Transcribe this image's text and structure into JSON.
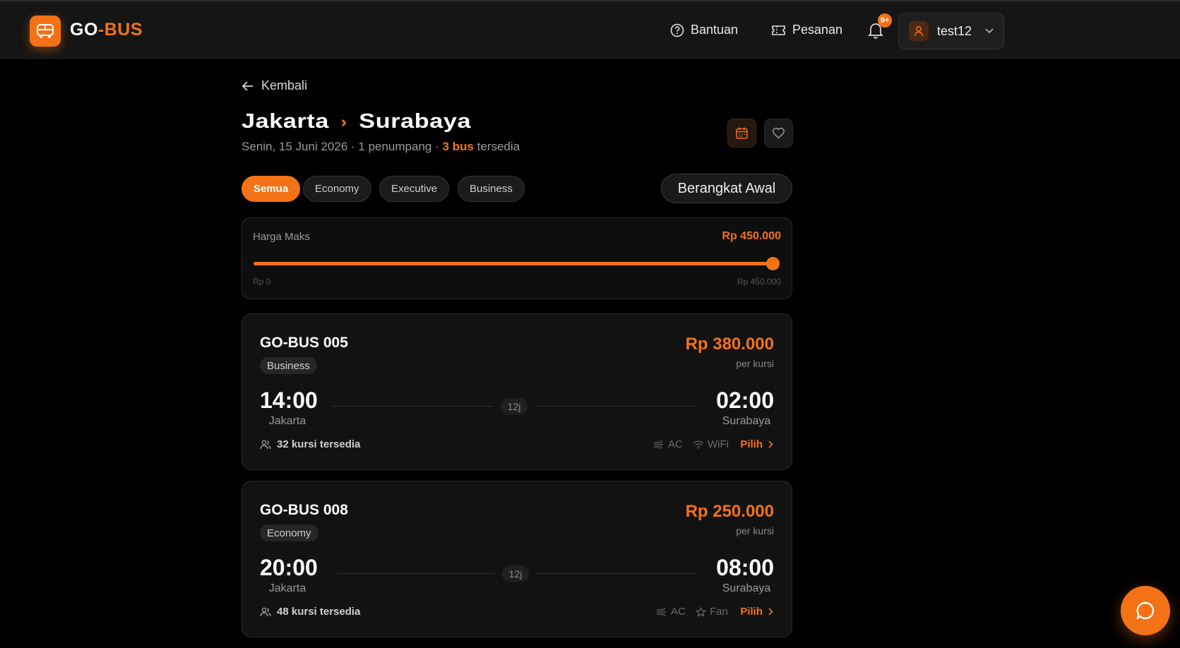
{
  "header": {
    "logo_prefix": "GO",
    "logo_dash": "-",
    "logo_suffix": "BUS",
    "nav": {
      "help": "Bantuan",
      "orders": "Pesanan"
    },
    "notification_badge": "9+",
    "user_name": "test12"
  },
  "page": {
    "back_label": "Kembali",
    "origin": "Jakarta",
    "destination": "Surabaya",
    "subtitle_prefix": "Senin, 15 Juni 2026 · 1 penumpang · ",
    "bus_count": "3 bus",
    "subtitle_suffix": " tersedia"
  },
  "filters": {
    "chips": [
      "Semua",
      "Economy",
      "Executive",
      "Business"
    ],
    "active_chip": "Semua",
    "sort_label": "Berangkat Awal"
  },
  "price_filter": {
    "label": "Harga Maks",
    "value": "Rp 450.000",
    "min_label": "Rp 0",
    "max_label": "Rp 450.000",
    "fill_fraction": 1.0
  },
  "results": [
    {
      "bus": "GO-BUS 005",
      "class": "Business",
      "price": "Rp 380.000",
      "per": "per kursi",
      "dep_time": "14:00",
      "dep_city": "Jakarta",
      "duration": "12j",
      "arr_time": "02:00",
      "arr_city": "Surabaya",
      "seats": "32 kursi tersedia",
      "amenities": [
        "AC",
        "WiFi"
      ],
      "amenity_icons": [
        "ac-icon",
        "wifi-icon"
      ],
      "action": "Pilih"
    },
    {
      "bus": "GO-BUS 008",
      "class": "Economy",
      "price": "Rp 250.000",
      "per": "per kursi",
      "dep_time": "20:00",
      "dep_city": "Jakarta",
      "duration": "12j",
      "arr_time": "08:00",
      "arr_city": "Surabaya",
      "seats": "48 kursi tersedia",
      "amenities": [
        "AC",
        "Fan"
      ],
      "amenity_icons": [
        "ac-icon",
        "star-icon"
      ],
      "action": "Pilih"
    }
  ],
  "colors": {
    "accent": "#f47216",
    "background": "#000000",
    "surface": "#121212"
  }
}
